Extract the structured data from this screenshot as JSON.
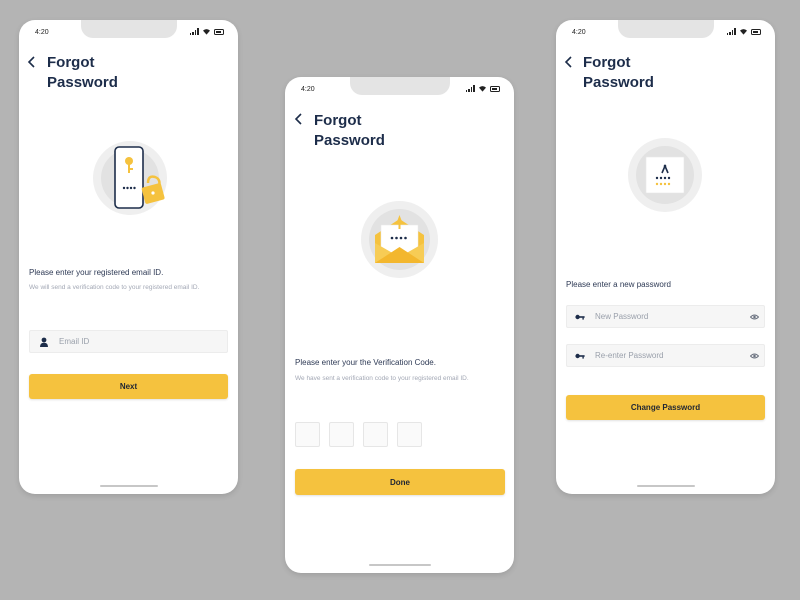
{
  "colors": {
    "accent": "#f5c23e",
    "navy": "#1d2d4a",
    "background": "#b4b4b4"
  },
  "screens": [
    {
      "time": "4:20",
      "title_line1": "Forgot",
      "title_line2": "Password",
      "illustration": "phone-key-lock-icon",
      "label": "Please enter your registered email ID.",
      "sub": "We will send a verification code to your registered email ID.",
      "email_placeholder": "Email ID",
      "button": "Next"
    },
    {
      "time": "4:20",
      "title_line1": "Forgot",
      "title_line2": "Password",
      "illustration": "envelope-code-icon",
      "label": "Please enter your the Verification Code.",
      "sub": "We have sent a verification code to your registered email ID.",
      "code_boxes": [
        "",
        "",
        "",
        ""
      ],
      "button": "Done"
    },
    {
      "time": "4:20",
      "title_line1": "Forgot",
      "title_line2": "Password",
      "illustration": "password-card-icon",
      "label": "Please enter a new password",
      "new_password_placeholder": "New Password",
      "reenter_password_placeholder": "Re-enter Password",
      "button": "Change Password"
    }
  ]
}
